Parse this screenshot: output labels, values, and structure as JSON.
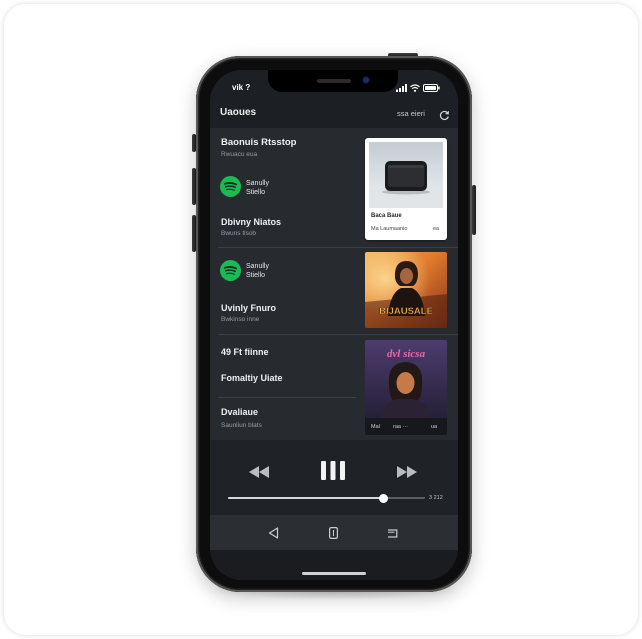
{
  "status_bar": {
    "carrier": "vik ?",
    "icons": [
      "signal-icon",
      "wifi-icon",
      "battery-icon"
    ]
  },
  "header": {
    "title": "Uaoues",
    "action_label": "ssa eieri",
    "action_icon": "refresh-icon"
  },
  "feed": [
    {
      "title": "Baonuis Rtsstop",
      "subtitle": "Rwuacu eua",
      "source": {
        "icon": "spotify-icon",
        "line1": "Sanully",
        "line2": "Stiello"
      },
      "track": {
        "title": "Dbivny Niatos",
        "subtitle": "Bwuns tlsob"
      },
      "card": {
        "image": "speaker-art",
        "caption_title": "Baca Baue",
        "caption_left": "Ma Laumaanio",
        "caption_right": "ea"
      }
    },
    {
      "source": {
        "icon": "spotify-icon",
        "line1": "Sanully",
        "line2": "Stiello"
      },
      "track": {
        "title": "Uvinly Fnuro",
        "subtitle": "Bwkinso inne"
      },
      "card": {
        "image": "sunset-portrait-art",
        "overlay_text": "BIJAUSALE"
      }
    },
    {
      "title": "49 Ft fiinne",
      "item": "Fomaltiy Uiate",
      "track": {
        "title": "Dvaliaue",
        "subtitle": "Saunliun blats"
      },
      "card": {
        "image": "purple-portrait-art",
        "overlay_text": "dvl sicsa",
        "caption_left": "Mal",
        "caption_mid": "raa ···",
        "caption_right": "ua"
      }
    }
  ],
  "player": {
    "controls": [
      "rewind-icon",
      "pause-icon",
      "fast-forward-icon"
    ],
    "progress": 0.79,
    "time": "3 212"
  },
  "nav_bar": {
    "buttons": [
      "back-icon",
      "home-icon",
      "recents-icon"
    ]
  },
  "colors": {
    "accent": "#1db954",
    "screen_bg": "#272b30",
    "header_bg": "#1c1f23",
    "player_bg": "#1f2226",
    "nav_bg": "#2b2e33",
    "text_primary": "#eef0f2",
    "text_secondary": "#979da4"
  }
}
